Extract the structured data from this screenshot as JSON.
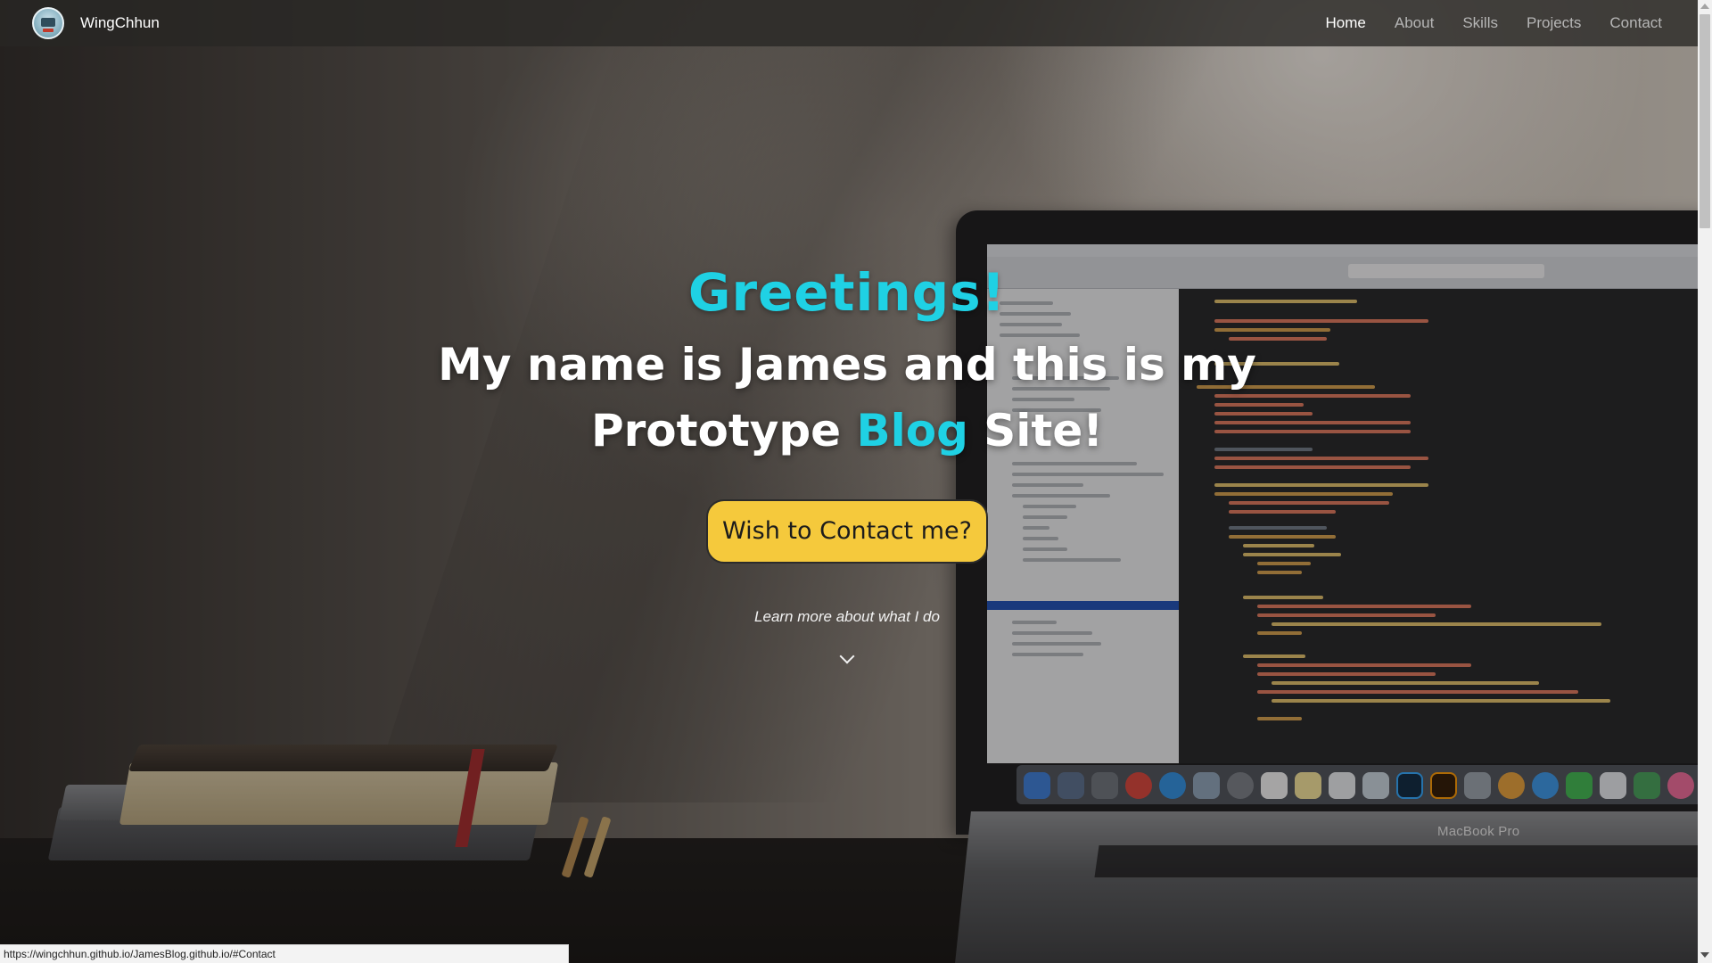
{
  "navbar": {
    "brand_name": "WingChhun",
    "logo_icon": "avatar-logo-icon",
    "links": [
      {
        "label": "Home",
        "active": true
      },
      {
        "label": "About",
        "active": false
      },
      {
        "label": "Skills",
        "active": false
      },
      {
        "label": "Projects",
        "active": false
      },
      {
        "label": "Contact",
        "active": false
      }
    ]
  },
  "hero": {
    "greeting": "Greetings!",
    "headline_line1": "My name is James and this is my",
    "headline_prefix": "Prototype ",
    "headline_accent": "Blog",
    "headline_suffix": " Site!",
    "cta_label": "Wish to Contact me?",
    "learn_more": "Learn more about what I do",
    "scroll_icon": "chevron-down-icon"
  },
  "background": {
    "laptop_label": "MacBook Pro"
  },
  "status_bar": {
    "url": "https://wingchhun.github.io/JamesBlog.github.io/#Contact"
  },
  "colors": {
    "accent": "#1fd1e4",
    "cta": "#f5c93c",
    "nav_active": "#ffffff",
    "nav_inactive": "#b6b6b6"
  }
}
